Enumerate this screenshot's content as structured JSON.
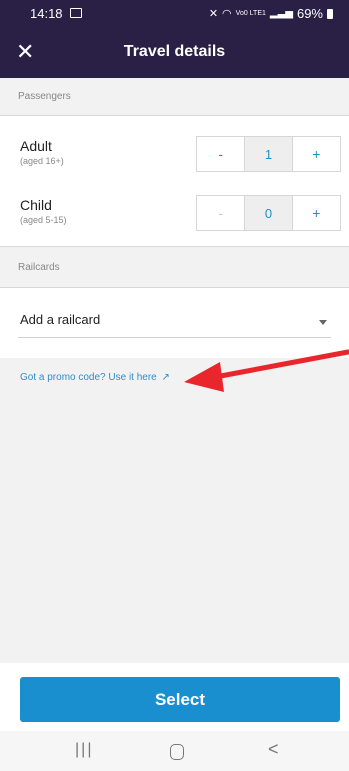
{
  "status_bar": {
    "time": "14:18",
    "network": "Vo0 LTE1",
    "battery": "69%"
  },
  "app_bar": {
    "title": "Travel details",
    "close_glyph": "✕"
  },
  "passengers": {
    "header": "Passengers",
    "rows": [
      {
        "label": "Adult",
        "age": "(aged 16+)",
        "count": "1",
        "minus": "-",
        "plus": "+"
      },
      {
        "label": "Child",
        "age": "(aged 5-15)",
        "count": "0",
        "minus": "-",
        "plus": "+"
      }
    ]
  },
  "railcards": {
    "header": "Railcards",
    "select_label": "Add a railcard"
  },
  "promo": {
    "text": "Got a promo code? Use it here",
    "icon": "↗"
  },
  "select_button": {
    "label": "Select"
  },
  "colors": {
    "app_bar": "#2a1f45",
    "accent": "#1a8fd0",
    "annotation": "#e8262b"
  }
}
